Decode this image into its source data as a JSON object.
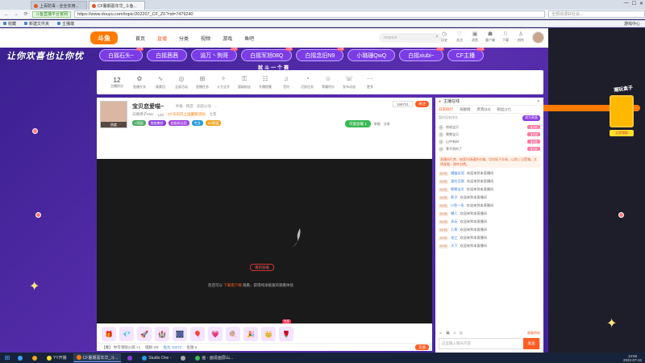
{
  "browser": {
    "tabs": [
      {
        "label": "上百防毒 - 全全实用..."
      },
      {
        "label": "CF暑期嘉年华_斗鱼..."
      }
    ],
    "nav_back": "←",
    "nav_forward": "→",
    "nav_refresh": "⟳",
    "shield_label": "斗鱼直播平台官网",
    "url": "https://www.douyu.com/topic/202207_CF_ZF?rid=7479240",
    "search_placeholder": "全部动漫好社会...",
    "win_min": "—",
    "win_max": "☐",
    "win_close": "✕",
    "bookmarks": [
      {
        "label": "收藏"
      },
      {
        "label": "新建文件夹"
      },
      {
        "label": "主播端"
      }
    ],
    "sidebar_text": "游戏中心"
  },
  "douyu": {
    "logo": "斗鱼",
    "nav": [
      {
        "label": "首页",
        "active": false
      },
      {
        "label": "直播",
        "active": true
      },
      {
        "label": "分类",
        "active": false
      },
      {
        "label": "视频",
        "active": false
      },
      {
        "label": "游戏",
        "active": false
      },
      {
        "label": "鱼吧",
        "active": false
      }
    ],
    "search_placeholder": "mspool",
    "user_icons": [
      {
        "glyph": "◷",
        "label": "历史"
      },
      {
        "glyph": "♡",
        "label": "关注"
      },
      {
        "glyph": "▣",
        "label": "消息"
      },
      {
        "glyph": "☗",
        "label": "客户端"
      },
      {
        "glyph": "⚐",
        "label": "下载"
      },
      {
        "glyph": "♙",
        "label": "创作"
      }
    ]
  },
  "event": {
    "banner": "让你欢喜也让你忧",
    "subtitle": "就斗一个赛",
    "pills": [
      {
        "label": "白摇石头~",
        "live": "LIVE"
      },
      {
        "label": "白摇茜茜",
        "live": ""
      },
      {
        "label": "渝万丶狗哥",
        "live": "LIVE"
      },
      {
        "label": "白摇军旭08Q",
        "live": "LIVE"
      },
      {
        "label": "白摇念旧N9",
        "live": "LIVE"
      },
      {
        "label": "小璐珊QwQ",
        "live": ""
      },
      {
        "label": "白摇xiubi~",
        "live": "LIVE"
      },
      {
        "label": "CF主播",
        "live": "LIVE"
      }
    ]
  },
  "toolbar": {
    "count": "12",
    "count_label": "主播积分",
    "tools": [
      {
        "glyph": "✿",
        "label": "直播开关"
      },
      {
        "glyph": "∿",
        "label": "像素回"
      },
      {
        "glyph": "◎",
        "label": "全部活动"
      },
      {
        "glyph": "⊞",
        "label": "直播任务"
      },
      {
        "glyph": "✧",
        "label": "火力全开"
      },
      {
        "glyph": "⚿",
        "label": "超级粉丝"
      },
      {
        "glyph": "☷",
        "label": "开播提醒"
      },
      {
        "glyph": "♫",
        "label": "音符"
      },
      {
        "glyph": "◔",
        "label": "活跃任务"
      },
      {
        "glyph": "☺",
        "label": "荣耀积分"
      },
      {
        "glyph": "☏",
        "label": "发布动态"
      },
      {
        "glyph": "⋯",
        "label": "更多"
      }
    ],
    "pc_button": "PC客户端",
    "pc_sub": "全网最快推流"
  },
  "room": {
    "title": "宝贝恋爱喵~",
    "sub": "· 举报 · 网游 · 穿越火线 · ...",
    "avatar_tag": "热度",
    "meta": [
      {
        "label": "天赐佛子Max",
        "orange": false
      },
      {
        "label": "120",
        "orange": false
      },
      {
        "label": "CF天天向上送暑期活动",
        "orange": true
      },
      {
        "label": "七年",
        "orange": false
      }
    ],
    "tags": [
      {
        "label": "V领勋",
        "color": "#4fae68"
      },
      {
        "label": "猫猫撒娇",
        "color": "#8a3de0"
      },
      {
        "label": "超级粉丝团",
        "color": "#a144e0"
      },
      {
        "label": "专业",
        "color": "#2b9de0"
      },
      {
        "label": "AR联盟",
        "color": "#f0a623"
      }
    ],
    "follow_count": "169721",
    "subscribe": "关注",
    "green_btn": "可爱加载",
    "green_count": "1",
    "report": "举报",
    "share": "分享"
  },
  "video": {
    "offline_btn": "重新加载",
    "message_pre": "您还可以",
    "message_link": "下载客户端",
    "message_post": "观看，获得纯净极速的观看体验",
    "time": "06:40",
    "red_tag": "免费",
    "plus": "+"
  },
  "gifts": {
    "items": [
      "🎁",
      "💎",
      "🚀",
      "🏰",
      "🎆",
      "🎈",
      "💗",
      "🍭",
      "🎉",
      "👑",
      "🌹"
    ],
    "strip_left": "【魔】 你可领取火箭 ×1",
    "strip_mid": "喵粉 2/5",
    "strip_blue": "鱼丸 14272",
    "strip_coins": "鱼翅 0",
    "recharge": "充值"
  },
  "chat": {
    "head_label": "主播在线",
    "close": "✕",
    "tabs": [
      {
        "label": "日常排行",
        "active": true
      },
      {
        "label": "贡献榜",
        "active": false
      },
      {
        "label": "贵宾(42)",
        "active": false
      },
      {
        "label": "粉丝(17)",
        "active": false
      }
    ],
    "rank_text": "暂时没有排名",
    "rank_btn": "成为贵族",
    "fans": [
      {
        "n": "1",
        "name": "哈哈宝贝",
        "badge": "宝贝恋"
      },
      {
        "n": "2",
        "name": "嗯嗯宝贝",
        "badge": "宝贝恋"
      },
      {
        "n": "3",
        "name": "山中有树",
        "badge": "宝贝恋"
      },
      {
        "n": "4",
        "name": "等不到你了",
        "badge": "宝贝恋"
      }
    ],
    "notice": "直播间打赏、抽奖时请谨防诈骗，切勿私下交易，以防上当受骗。文明观看，理性消费。",
    "messages": [
      {
        "lv": "LV 12",
        "user": "橘猫无语",
        "text": "欢迎来到本直播间"
      },
      {
        "lv": "LV 10",
        "user": "爱吃豆腐",
        "text": "欢迎来到本直播间"
      },
      {
        "lv": "LV 11",
        "user": "嗯嗯宝贝",
        "text": "欢迎来到本直播间"
      },
      {
        "lv": "LV 15",
        "user": "影子",
        "text": "欢迎来到本直播间"
      },
      {
        "lv": "LV 11",
        "user": "小鱼一条",
        "text": "欢迎来到本直播间"
      },
      {
        "lv": "LV 16",
        "user": "懒人",
        "text": "欢迎来到本直播间"
      },
      {
        "lv": "LV 13",
        "user": "多玩",
        "text": "欢迎来到本直播间"
      },
      {
        "lv": "LV 13",
        "user": "九哥",
        "text": "欢迎来到本直播间"
      },
      {
        "lv": "LV 10",
        "user": "张三",
        "text": "欢迎来到本直播间"
      },
      {
        "lv": "LV 12",
        "user": "天下",
        "text": "欢迎来到本直播间"
      }
    ],
    "tools": [
      "☺",
      "▣",
      "♫",
      "◎"
    ],
    "lock_label": "屏蔽特效",
    "input_placeholder": "这里输入聊天内容",
    "send": "发送"
  },
  "promo": {
    "title": "潮玩盒子",
    "button": "立即领取"
  },
  "taskbar": {
    "start": "⊞",
    "items": [
      {
        "label": "",
        "color": "#3ba1ff",
        "active": false
      },
      {
        "label": "",
        "color": "#f0a623",
        "active": false
      },
      {
        "label": "YY开播",
        "color": "#ffde2f",
        "active": false
      },
      {
        "label": "CF暑期嘉年华_斗...",
        "color": "#ff7a00",
        "active": true
      },
      {
        "label": "",
        "color": "#8a3de0",
        "active": false
      },
      {
        "label": "Studio One -",
        "color": "#2b9de0",
        "active": false
      },
      {
        "label": "",
        "color": "#aaaaaa",
        "active": false
      },
      {
        "label": "画 - 画说画层山...",
        "color": "#3cba54",
        "active": false
      }
    ],
    "time": "13:56",
    "date": "2022-07-24"
  }
}
